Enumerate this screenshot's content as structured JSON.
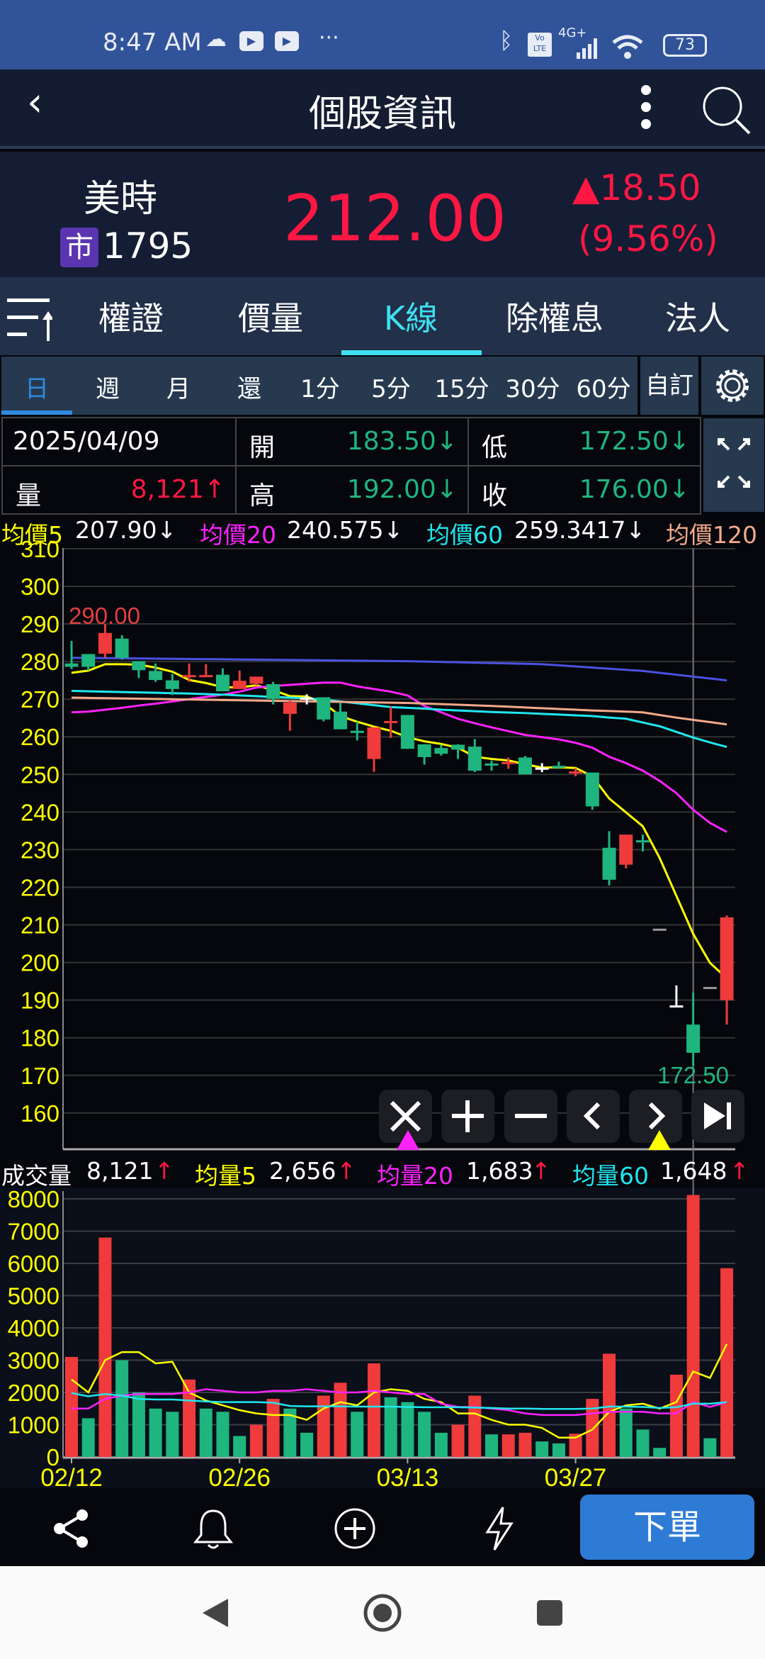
{
  "status_bar": {
    "time": "8:47 AM",
    "battery": "73",
    "network": "4G+"
  },
  "header": {
    "title": "個股資訊"
  },
  "stock": {
    "name": "美時",
    "market_badge": "市",
    "code": "1795",
    "price": "212.00",
    "change": "▲18.50",
    "change_pct": "(9.56%)"
  },
  "tabs": [
    {
      "label": "權證"
    },
    {
      "label": "價量"
    },
    {
      "label": "K線",
      "active": true
    },
    {
      "label": "除權息"
    },
    {
      "label": "法人"
    }
  ],
  "periods": [
    {
      "label": "日",
      "active": true
    },
    {
      "label": "週"
    },
    {
      "label": "月"
    },
    {
      "label": "還"
    },
    {
      "label": "1分"
    },
    {
      "label": "5分"
    },
    {
      "label": "15分"
    },
    {
      "label": "30分"
    },
    {
      "label": "60分"
    }
  ],
  "custom_label": "自訂",
  "quote": {
    "date": "2025/04/09",
    "open_label": "開",
    "open": "183.50↓",
    "low_label": "低",
    "low": "172.50↓",
    "vol_label": "量",
    "vol": "8,121↑",
    "high_label": "高",
    "high": "192.00↓",
    "close_label": "收",
    "close": "176.00↓"
  },
  "ma_legend": [
    {
      "label": "均價5",
      "value": "207.90↓",
      "color": "#ffff00"
    },
    {
      "label": "均價20",
      "value": "240.575↓",
      "color": "#ff22ff"
    },
    {
      "label": "均價60",
      "value": "259.3417↓",
      "color": "#22e6ee"
    },
    {
      "label": "均價120",
      "value": "",
      "color": "#f4a98a"
    }
  ],
  "vol_legend": {
    "label": "成交量",
    "value": "8,121",
    "ma": [
      {
        "label": "均量5",
        "value": "2,656"
      },
      {
        "label": "均量20",
        "value": "1,683"
      },
      {
        "label": "均量60",
        "value": "1,648"
      }
    ],
    "arrow": "↑"
  },
  "chart_controls": [
    "close",
    "zoom-in",
    "zoom-out",
    "prev",
    "next",
    "end"
  ],
  "toolbar": {
    "order_label": "下單"
  },
  "chart_data": {
    "type": "candlestick",
    "price_ylim": [
      151,
      311
    ],
    "price_ticks": [
      160,
      170,
      180,
      190,
      200,
      210,
      220,
      230,
      240,
      250,
      260,
      270,
      280,
      290,
      300,
      310
    ],
    "max_label": "290.00",
    "min_label": "172.50",
    "selected_index": 37,
    "x_labels": [
      {
        "index": 0,
        "label": "02/12"
      },
      {
        "index": 10,
        "label": "02/26"
      },
      {
        "index": 20,
        "label": "03/13"
      },
      {
        "index": 30,
        "label": "03/27"
      }
    ],
    "candles": [
      [
        279.5,
        285.5,
        278,
        278.6
      ],
      [
        282,
        282,
        277.6,
        278.6
      ],
      [
        282.1,
        290,
        281,
        287.6
      ],
      [
        286.1,
        287,
        280.5,
        281
      ],
      [
        280.1,
        280.1,
        275.6,
        277.7
      ],
      [
        277.5,
        279.5,
        274.6,
        275.1
      ],
      [
        275,
        276.7,
        271.1,
        272.7
      ],
      [
        276.3,
        279.5,
        274.6,
        276.4,
        "r"
      ],
      [
        276.3,
        279.3,
        276.3,
        276.4,
        "r"
      ],
      [
        276.5,
        278.2,
        272.1,
        272.1
      ],
      [
        272.7,
        277.6,
        272.7,
        274.9
      ],
      [
        274.1,
        276,
        273.6,
        276
      ],
      [
        274,
        274.6,
        268.6,
        270.1
      ],
      [
        266.1,
        269.6,
        261.6,
        269.1
      ],
      [
        270.4,
        271.3,
        268.6,
        270.4,
        "w"
      ],
      [
        270.5,
        270.5,
        264.1,
        264.6
      ],
      [
        266.7,
        269.1,
        262,
        262
      ],
      [
        261.6,
        264,
        259,
        261.6,
        "g"
      ],
      [
        254.1,
        262.5,
        250.7,
        262.5
      ],
      [
        263.8,
        268,
        259.7,
        264.2
      ],
      [
        265.8,
        265.8,
        256.8,
        256.8
      ],
      [
        258,
        258,
        252.6,
        254.6
      ],
      [
        257,
        257.8,
        255,
        255.5
      ],
      [
        257.9,
        258,
        254.1,
        256.6
      ],
      [
        257.4,
        259.4,
        250.6,
        251
      ],
      [
        252.9,
        253.7,
        251,
        252.9,
        "g"
      ],
      [
        253.3,
        254.5,
        251.5,
        253.3,
        "r"
      ],
      [
        254.5,
        254.9,
        250,
        250
      ],
      [
        251.8,
        253,
        250.6,
        251.8,
        "w"
      ],
      [
        252.3,
        253.4,
        251.5,
        252.3,
        "g"
      ],
      [
        250.8,
        251.7,
        249.5,
        250.8,
        "r"
      ],
      [
        250.5,
        250.5,
        240.6,
        241.5
      ],
      [
        230.5,
        234.9,
        220.5,
        222
      ],
      [
        226,
        234,
        225,
        234
      ],
      [
        232.5,
        234,
        229.5,
        232.5,
        "g"
      ],
      [
        209,
        209,
        209,
        209,
        "x"
      ],
      [
        188.6,
        193.9,
        188.6,
        188.6,
        "w"
      ],
      [
        183.5,
        192,
        172.5,
        176
      ],
      [
        193.5,
        193.5,
        193.5,
        193.5,
        "x"
      ],
      [
        190,
        212.5,
        183.5,
        212
      ]
    ],
    "ma": [
      {
        "name": "均價5",
        "color": "#ffff00",
        "values": [
          277,
          277.6,
          279.3,
          279.3,
          279.2,
          278.4,
          277.3,
          275.1,
          274.3,
          273.2,
          273.1,
          273.7,
          272.4,
          270.8,
          270.7,
          269,
          265.5,
          264,
          262.7,
          261.6,
          259.9,
          258.8,
          258.1,
          257.1,
          254.7,
          254.1,
          253.7,
          252.7,
          251.8,
          251.9,
          251.7,
          249.5,
          243.6,
          239.9,
          236.2,
          227.8,
          217.7,
          207.6,
          199.9,
          195.8
        ]
      },
      {
        "name": "均價20",
        "color": "#ff22ff",
        "values": [
          266.5,
          266.7,
          267.2,
          267.7,
          268.3,
          268.8,
          269.4,
          270,
          270.6,
          271.2,
          272,
          273.1,
          273.5,
          273.8,
          274.1,
          274.4,
          274.4,
          273.4,
          272.7,
          272,
          271,
          268.2,
          266.5,
          264.8,
          263.6,
          262.5,
          261.5,
          260.5,
          259.9,
          259.3,
          258.4,
          257.1,
          254.7,
          253,
          251,
          248.3,
          245,
          240.6,
          237.1,
          234.7
        ]
      },
      {
        "name": "均價60",
        "color": "#22e6ee",
        "values": [
          272.2,
          272.1,
          272,
          271.9,
          271.8,
          271.7,
          271.6,
          271.5,
          271.35,
          271.2,
          271,
          270.8,
          270.6,
          270.4,
          270.2,
          269.9,
          269.4,
          268.9,
          268.4,
          267.9,
          267.7,
          267.5,
          267.2,
          267,
          266.8,
          266.6,
          266.45,
          266.3,
          266.1,
          265.9,
          265.7,
          265.5,
          265.1,
          264.8,
          263.8,
          262.8,
          261.3,
          259.8,
          258.5,
          257.3
        ]
      },
      {
        "name": "均價120",
        "color": "#f4a98a",
        "values": [
          270.4,
          270.33,
          270.26,
          270.19,
          270.12,
          270.05,
          269.98,
          269.91,
          269.84,
          269.77,
          269.7,
          269.63,
          269.56,
          269.49,
          269.42,
          269.35,
          269.28,
          269.21,
          269.14,
          269.07,
          269,
          268.84,
          268.68,
          268.52,
          268.36,
          268.2,
          268,
          267.8,
          267.6,
          267.4,
          267.2,
          267,
          266.85,
          266.7,
          266.5,
          265.8,
          265.1,
          264.5,
          263.9,
          263.3
        ]
      },
      {
        "name": "long-ma",
        "color": "#4a52e0",
        "values": [
          281,
          280.96,
          280.91,
          280.87,
          280.82,
          280.78,
          280.73,
          280.69,
          280.64,
          280.6,
          280.55,
          280.51,
          280.46,
          280.42,
          280.37,
          280.33,
          280.28,
          280.24,
          280.19,
          280.15,
          280.1,
          280,
          279.9,
          279.8,
          279.7,
          279.6,
          279.5,
          279.4,
          279.3,
          279,
          278.7,
          278.4,
          278.1,
          277.8,
          277.5,
          277,
          276.5,
          276,
          275.5,
          275
        ]
      }
    ],
    "volume_ylim": [
      0,
      8000
    ],
    "volume_ticks": [
      0,
      1000,
      2000,
      3000,
      4000,
      5000,
      6000,
      7000,
      8000
    ],
    "volume": [
      [
        3100,
        "r"
      ],
      [
        1200,
        "g"
      ],
      [
        6800,
        "r"
      ],
      [
        3000,
        "g"
      ],
      [
        2000,
        "g"
      ],
      [
        1500,
        "g"
      ],
      [
        1400,
        "g"
      ],
      [
        2400,
        "r"
      ],
      [
        1500,
        "g"
      ],
      [
        1400,
        "g"
      ],
      [
        650,
        "g"
      ],
      [
        1000,
        "r"
      ],
      [
        1800,
        "r"
      ],
      [
        1500,
        "g"
      ],
      [
        750,
        "g"
      ],
      [
        1900,
        "r"
      ],
      [
        2300,
        "r"
      ],
      [
        1400,
        "g"
      ],
      [
        2900,
        "r"
      ],
      [
        1850,
        "g"
      ],
      [
        1700,
        "g"
      ],
      [
        1400,
        "g"
      ],
      [
        750,
        "g"
      ],
      [
        1000,
        "r"
      ],
      [
        1900,
        "r"
      ],
      [
        700,
        "g"
      ],
      [
        700,
        "r"
      ],
      [
        750,
        "r"
      ],
      [
        480,
        "g"
      ],
      [
        420,
        "g"
      ],
      [
        720,
        "r"
      ],
      [
        1800,
        "r"
      ],
      [
        3200,
        "r"
      ],
      [
        1500,
        "g"
      ],
      [
        850,
        "g"
      ],
      [
        280,
        "g"
      ],
      [
        2550,
        "r"
      ],
      [
        8121,
        "r"
      ],
      [
        580,
        "g"
      ],
      [
        5850,
        "r"
      ]
    ],
    "volume_ma": [
      {
        "name": "均量5",
        "color": "#ffff00",
        "values": [
          2400,
          2000,
          3000,
          3250,
          3250,
          2900,
          2950,
          2000,
          1750,
          1600,
          1450,
          1350,
          1300,
          1300,
          1150,
          1500,
          1700,
          1600,
          2000,
          2100,
          2050,
          1800,
          1700,
          1350,
          1350,
          1150,
          1000,
          1000,
          900,
          600,
          600,
          850,
          1400,
          1600,
          1650,
          1500,
          1700,
          2650,
          2450,
          3500
        ]
      },
      {
        "name": "均量20",
        "color": "#ff22ff",
        "values": [
          1500,
          1500,
          1800,
          1900,
          1950,
          1950,
          1950,
          2000,
          2100,
          2050,
          2000,
          2000,
          2050,
          2050,
          2100,
          2050,
          2000,
          2000,
          2050,
          2000,
          1950,
          1950,
          1650,
          1550,
          1550,
          1500,
          1450,
          1350,
          1300,
          1300,
          1300,
          1350,
          1400,
          1400,
          1400,
          1350,
          1350,
          1700,
          1550,
          1700
        ]
      },
      {
        "name": "均量60",
        "color": "#22e6ee",
        "values": [
          1980,
          1880,
          1950,
          1900,
          1800,
          1780,
          1780,
          1750,
          1720,
          1700,
          1700,
          1700,
          1680,
          1580,
          1570,
          1570,
          1570,
          1560,
          1560,
          1560,
          1550,
          1540,
          1540,
          1540,
          1530,
          1520,
          1500,
          1500,
          1490,
          1490,
          1490,
          1500,
          1560,
          1560,
          1550,
          1520,
          1540,
          1650,
          1650,
          1700
        ]
      }
    ]
  }
}
